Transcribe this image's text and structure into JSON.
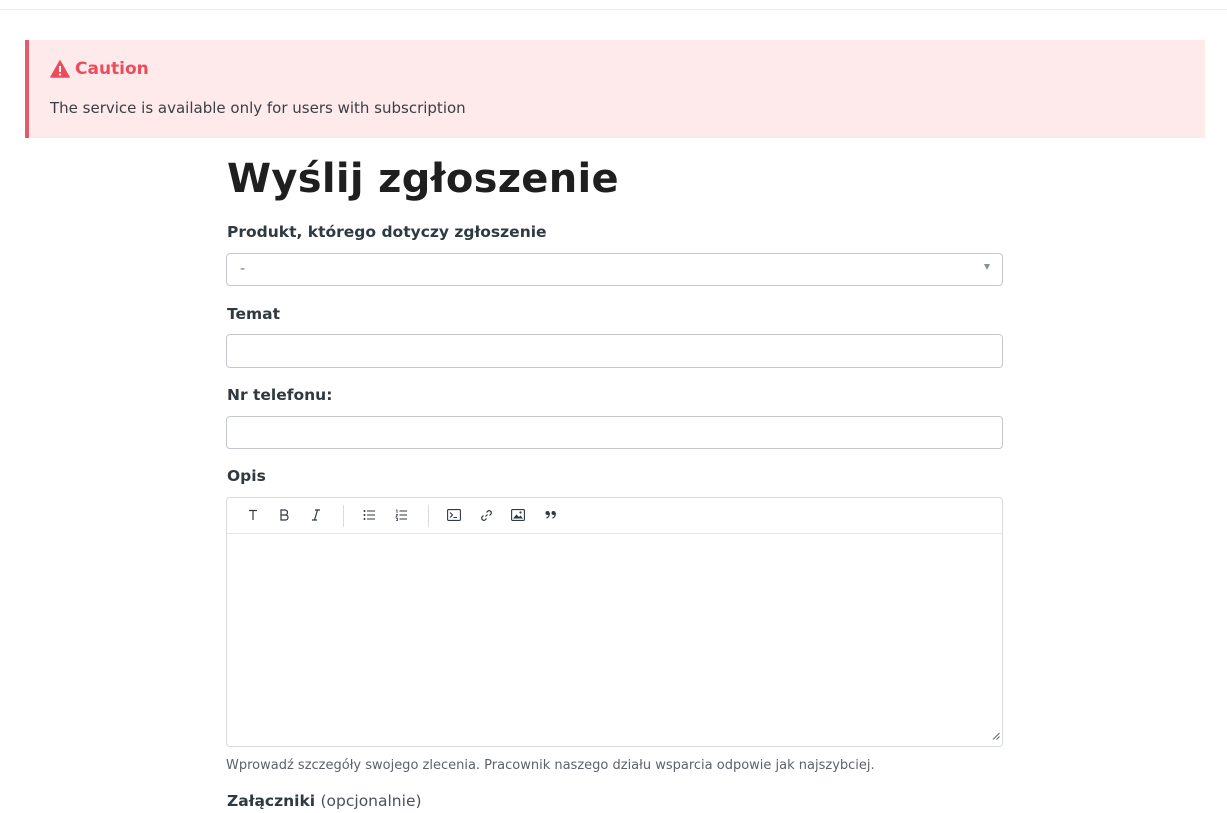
{
  "alert": {
    "title": "Caution",
    "message": "The service is available only for users with subscription",
    "icon": "warning-triangle-icon",
    "color": "#eb4d5c",
    "background": "#feeaea"
  },
  "form": {
    "title": "Wyślij zgłoszenie",
    "product": {
      "label": "Produkt, którego dotyczy zgłoszenie",
      "selected": "-"
    },
    "subject": {
      "label": "Temat",
      "value": ""
    },
    "phone": {
      "label": "Nr telefonu:",
      "value": ""
    },
    "description": {
      "label": "Opis",
      "value": "",
      "hint": "Wprowadź szczegóły swojego zlecenia. Pracownik naszego działu wsparcia odpowie jak najszybciej.",
      "toolbar": [
        "text-format-icon",
        "bold-icon",
        "italic-icon",
        "bulleted-list-icon",
        "numbered-list-icon",
        "code-block-icon",
        "link-icon",
        "image-icon",
        "quote-icon"
      ]
    },
    "attachments": {
      "label": "Załączniki",
      "optional": "(opcjonalnie)"
    }
  }
}
